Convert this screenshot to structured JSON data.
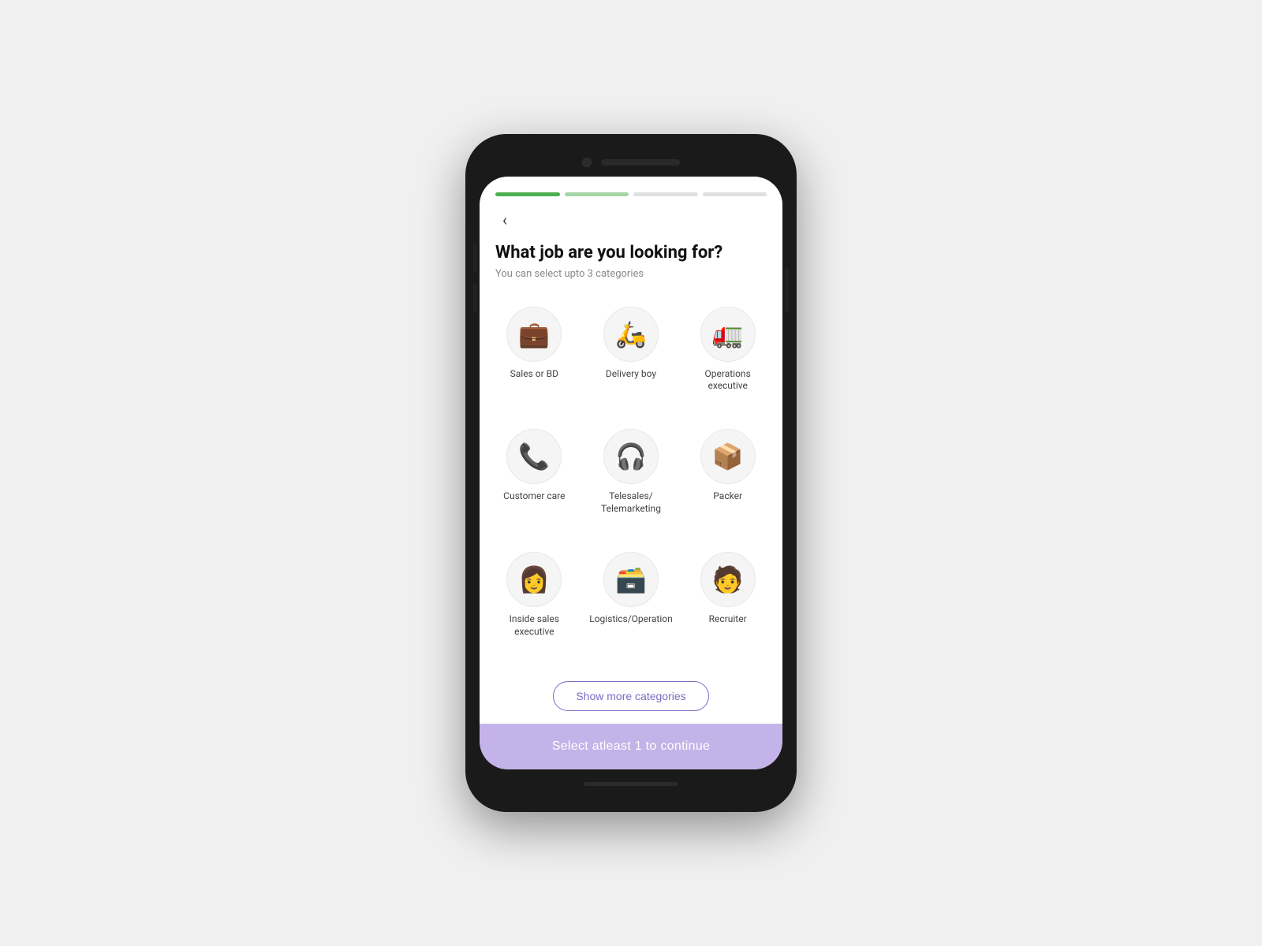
{
  "progress": {
    "segments": [
      {
        "state": "active"
      },
      {
        "state": "half"
      },
      {
        "state": "inactive"
      },
      {
        "state": "inactive"
      }
    ]
  },
  "header": {
    "back_label": "‹",
    "title": "What job are you looking for?",
    "subtitle": "You can select upto 3 categories"
  },
  "categories": [
    {
      "id": "sales-bd",
      "label": "Sales or BD",
      "icon": "💼"
    },
    {
      "id": "delivery-boy",
      "label": "Delivery boy",
      "icon": "🛵"
    },
    {
      "id": "operations-executive",
      "label": "Operations executive",
      "icon": "🚛"
    },
    {
      "id": "customer-care",
      "label": "Customer care",
      "icon": "📞"
    },
    {
      "id": "telesales-telemarketing",
      "label": "Telesales/ Telemarketing",
      "icon": "🎧"
    },
    {
      "id": "packer",
      "label": "Packer",
      "icon": "📦"
    },
    {
      "id": "inside-sales-executive",
      "label": "Inside sales executive",
      "icon": "👩"
    },
    {
      "id": "logistics-operation",
      "label": "Logistics/Operation",
      "icon": "🗃️"
    },
    {
      "id": "recruiter",
      "label": "Recruiter",
      "icon": "🧑"
    }
  ],
  "show_more_label": "Show more categories",
  "continue_label": "Select atleast 1 to continue"
}
